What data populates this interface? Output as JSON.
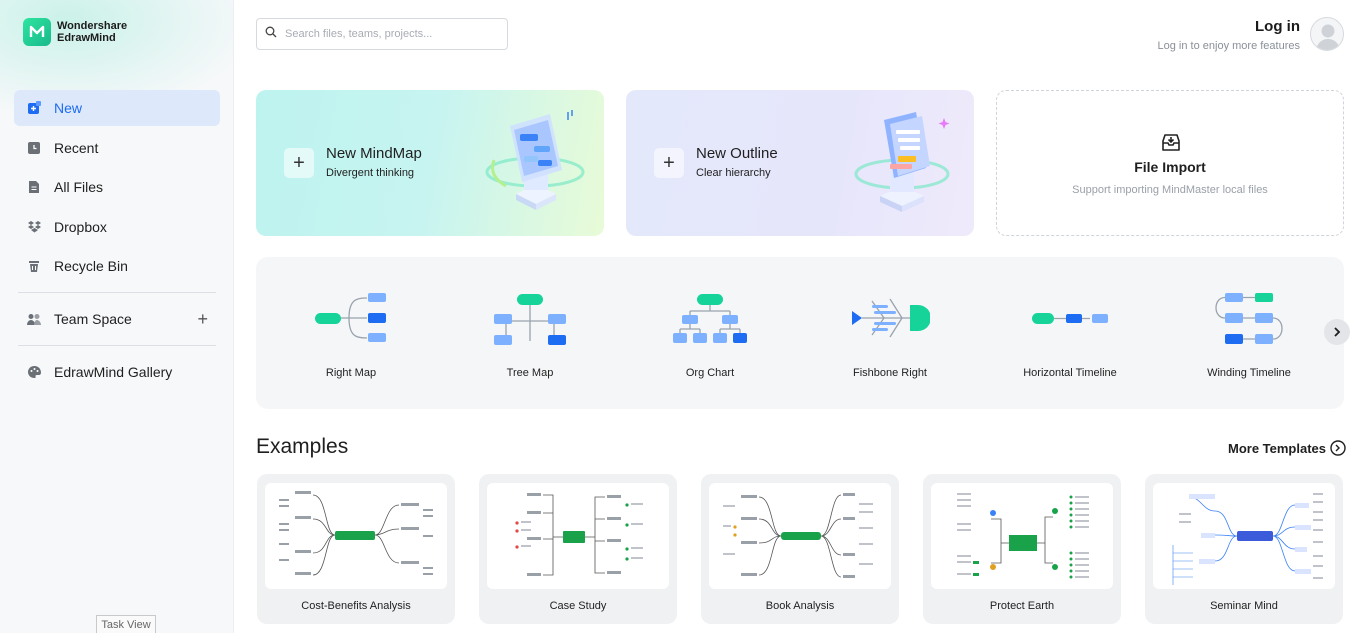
{
  "app": {
    "brand_line1": "Wondershare",
    "brand_line2": "EdrawMind"
  },
  "sidebar": {
    "items": [
      {
        "label": "New",
        "icon": "new-file-icon",
        "active": true
      },
      {
        "label": "Recent",
        "icon": "clock-icon"
      },
      {
        "label": "All Files",
        "icon": "document-icon"
      },
      {
        "label": "Dropbox",
        "icon": "dropbox-icon"
      },
      {
        "label": "Recycle Bin",
        "icon": "trash-icon"
      }
    ],
    "team_space": "Team Space",
    "gallery": "EdrawMind Gallery"
  },
  "search": {
    "placeholder": "Search files, teams, projects..."
  },
  "login": {
    "title": "Log in",
    "subtitle": "Log in to enjoy more features"
  },
  "cards": {
    "mindmap": {
      "title": "New MindMap",
      "subtitle": "Divergent thinking"
    },
    "outline": {
      "title": "New Outline",
      "subtitle": "Clear hierarchy"
    },
    "import": {
      "title": "File Import",
      "subtitle": "Support importing MindMaster local files"
    }
  },
  "templates": [
    "Right Map",
    "Tree Map",
    "Org Chart",
    "Fishbone Right",
    "Horizontal Timeline",
    "Winding Timeline"
  ],
  "examples": {
    "title": "Examples",
    "more": "More Templates",
    "items": [
      "Cost-Benefits Analysis",
      "Case Study",
      "Book Analysis",
      "Protect Earth",
      "Seminar Mind"
    ]
  },
  "taskbar": {
    "task_view": "Task View"
  },
  "colors": {
    "accent": "#1d6cf2",
    "green": "#16d39a",
    "light_blue": "#7db0ff"
  }
}
